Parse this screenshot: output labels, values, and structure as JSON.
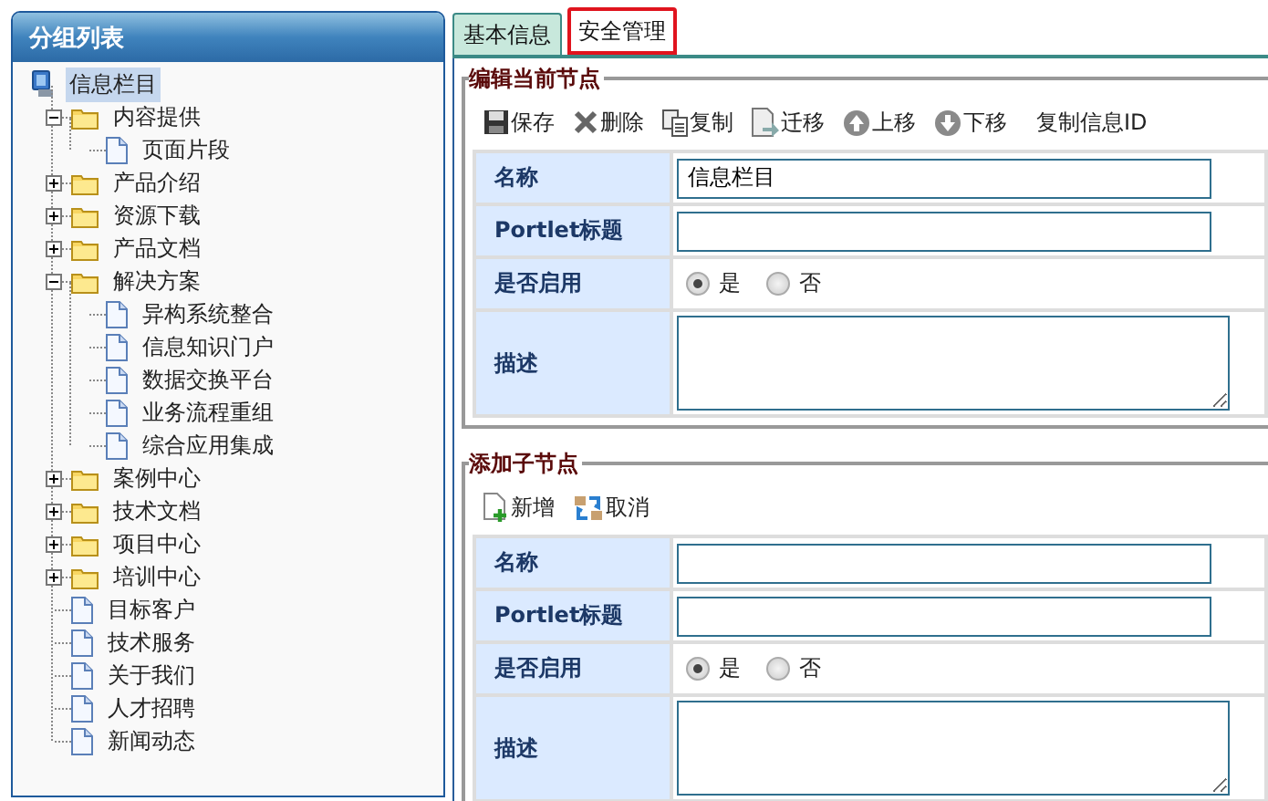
{
  "sidebar": {
    "title": "分组列表",
    "tree": [
      {
        "label": "信息栏目",
        "kind": "root",
        "selected": true,
        "expanded": true,
        "children": [
          {
            "label": "内容提供",
            "kind": "folder",
            "selected": false,
            "expanded": true,
            "children": [
              {
                "label": "页面片段",
                "kind": "page",
                "selected": false
              }
            ]
          },
          {
            "label": "产品介绍",
            "kind": "folder",
            "selected": false,
            "expanded": false
          },
          {
            "label": "资源下载",
            "kind": "folder",
            "selected": false,
            "expanded": false
          },
          {
            "label": "产品文档",
            "kind": "folder",
            "selected": false,
            "expanded": false
          },
          {
            "label": "解决方案",
            "kind": "folder",
            "selected": false,
            "expanded": true,
            "children": [
              {
                "label": "异构系统整合",
                "kind": "page",
                "selected": false
              },
              {
                "label": "信息知识门户",
                "kind": "page",
                "selected": false
              },
              {
                "label": "数据交换平台",
                "kind": "page",
                "selected": false
              },
              {
                "label": "业务流程重组",
                "kind": "page",
                "selected": false
              },
              {
                "label": "综合应用集成",
                "kind": "page",
                "selected": false
              }
            ]
          },
          {
            "label": "案例中心",
            "kind": "folder",
            "selected": false,
            "expanded": false
          },
          {
            "label": "技术文档",
            "kind": "folder",
            "selected": false,
            "expanded": false
          },
          {
            "label": "项目中心",
            "kind": "folder",
            "selected": false,
            "expanded": false
          },
          {
            "label": "培训中心",
            "kind": "folder",
            "selected": false,
            "expanded": false
          },
          {
            "label": "目标客户",
            "kind": "page",
            "selected": false
          },
          {
            "label": "技术服务",
            "kind": "page",
            "selected": false
          },
          {
            "label": "关于我们",
            "kind": "page",
            "selected": false
          },
          {
            "label": "人才招聘",
            "kind": "page",
            "selected": false
          },
          {
            "label": "新闻动态",
            "kind": "page",
            "selected": false
          }
        ]
      }
    ]
  },
  "tabs": [
    {
      "label": "基本信息",
      "selected": false
    },
    {
      "label": "安全管理",
      "selected": true
    }
  ],
  "sections": [
    {
      "title": "编辑当前节点",
      "toolbar": [
        {
          "label": "保存",
          "kind": "save"
        },
        {
          "label": "删除",
          "kind": "delete"
        },
        {
          "label": "复制",
          "kind": "copy"
        },
        {
          "label": "迁移",
          "kind": "move"
        },
        {
          "label": "上移",
          "kind": "up"
        },
        {
          "label": "下移",
          "kind": "down"
        },
        {
          "label": "复制信息ID",
          "kind": "text"
        }
      ],
      "fields": [
        {
          "label": "名称",
          "kind": "text",
          "value": "信息栏目"
        },
        {
          "label": "Portlet标题",
          "kind": "text"
        },
        {
          "label": "是否启用",
          "kind": "radio",
          "options": [
            {
              "label": "是",
              "selected": true
            },
            {
              "label": "否",
              "selected": false
            }
          ]
        },
        {
          "label": "描述",
          "kind": "textarea"
        }
      ]
    },
    {
      "title": "添加子节点",
      "toolbar": [
        {
          "label": "新增",
          "kind": "add"
        },
        {
          "label": "取消",
          "kind": "cancel"
        }
      ],
      "fields": [
        {
          "label": "名称",
          "kind": "text"
        },
        {
          "label": "Portlet标题",
          "kind": "text"
        },
        {
          "label": "是否启用",
          "kind": "radio",
          "options": [
            {
              "label": "是",
              "selected": true
            },
            {
              "label": "否",
              "selected": false
            }
          ]
        },
        {
          "label": "描述",
          "kind": "textarea"
        }
      ]
    }
  ]
}
